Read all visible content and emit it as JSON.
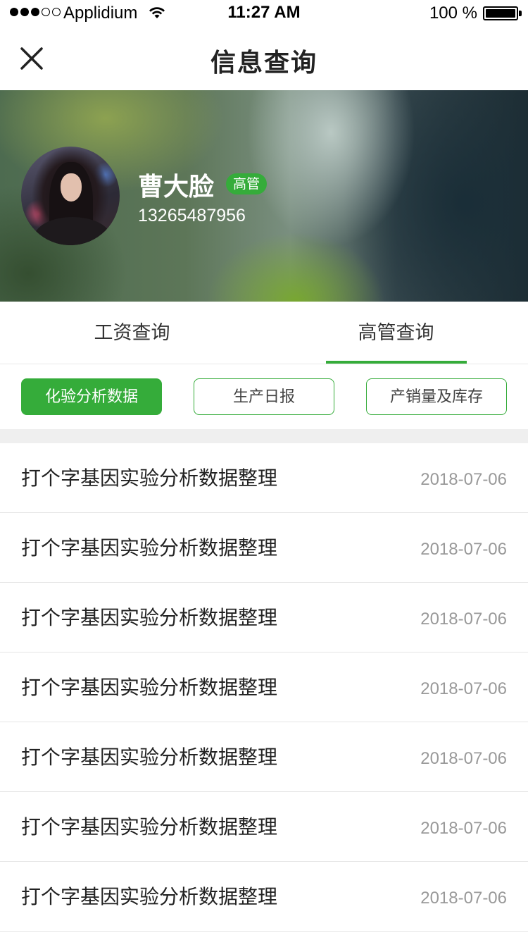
{
  "status_bar": {
    "carrier": "Applidium",
    "time": "11:27 AM",
    "battery": "100 %"
  },
  "nav": {
    "title": "信息查询",
    "close_icon": "close-icon"
  },
  "profile": {
    "name": "曹大脸",
    "role": "高管",
    "phone": "13265487956"
  },
  "tabs": [
    {
      "label": "工资查询",
      "active": false
    },
    {
      "label": "高管查询",
      "active": true
    }
  ],
  "filters": [
    {
      "label": "化验分析数据",
      "active": true
    },
    {
      "label": "生产日报",
      "active": false
    },
    {
      "label": "产销量及库存",
      "active": false
    }
  ],
  "list": [
    {
      "title": "打个字基因实验分析数据整理",
      "date": "2018-07-06"
    },
    {
      "title": "打个字基因实验分析数据整理",
      "date": "2018-07-06"
    },
    {
      "title": "打个字基因实验分析数据整理",
      "date": "2018-07-06"
    },
    {
      "title": "打个字基因实验分析数据整理",
      "date": "2018-07-06"
    },
    {
      "title": "打个字基因实验分析数据整理",
      "date": "2018-07-06"
    },
    {
      "title": "打个字基因实验分析数据整理",
      "date": "2018-07-06"
    },
    {
      "title": "打个字基因实验分析数据整理",
      "date": "2018-07-06"
    }
  ],
  "colors": {
    "accent": "#35ac3a",
    "date_text": "#999999",
    "separator_band": "#efefef"
  }
}
